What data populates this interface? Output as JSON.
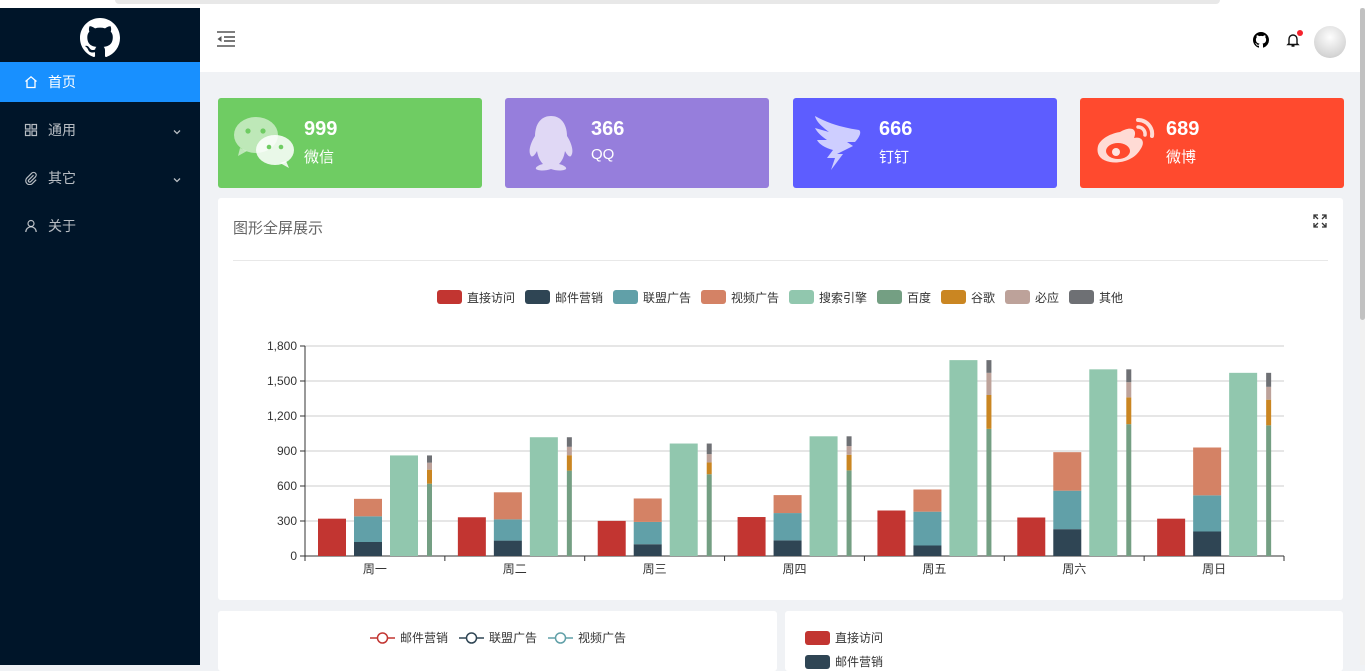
{
  "sidebar": {
    "items": [
      {
        "label": "首页",
        "icon": "home-icon",
        "active": true
      },
      {
        "label": "通用",
        "icon": "appstore-icon",
        "has_submenu": true
      },
      {
        "label": "其它",
        "icon": "paper-clip-icon",
        "has_submenu": true
      },
      {
        "label": "关于",
        "icon": "user-icon"
      }
    ]
  },
  "header": {
    "icons": [
      "menu-fold-icon",
      "github-icon",
      "bell-icon",
      "avatar"
    ]
  },
  "stats": [
    {
      "value": "999",
      "label": "微信",
      "color": "#6fcc63",
      "icon": "wechat-icon"
    },
    {
      "value": "366",
      "label": "QQ",
      "color": "#967edc",
      "icon": "qq-icon"
    },
    {
      "value": "666",
      "label": "钉钉",
      "color": "#5d5dff",
      "icon": "dingtalk-icon"
    },
    {
      "value": "689",
      "label": "微博",
      "color": "#ff4a2e",
      "icon": "weibo-icon"
    }
  ],
  "panel": {
    "title": "图形全屏展示"
  },
  "chart_data": {
    "type": "bar",
    "categories": [
      "周一",
      "周二",
      "周三",
      "周四",
      "周五",
      "周六",
      "周日"
    ],
    "y_ticks": [
      "0",
      "300",
      "600",
      "900",
      "1,200",
      "1,500",
      "1,800"
    ],
    "ylim": [
      0,
      1800
    ],
    "legend_position": "top-center",
    "grid": true,
    "series": [
      {
        "name": "直接访问",
        "stack": "direct",
        "color": "#c23531",
        "values": [
          320,
          332,
          301,
          334,
          390,
          330,
          320
        ]
      },
      {
        "name": "邮件营销",
        "stack": "ad",
        "color": "#2f4554",
        "values": [
          120,
          132,
          101,
          134,
          90,
          230,
          210
        ]
      },
      {
        "name": "联盟广告",
        "stack": "ad",
        "color": "#61a0a8",
        "values": [
          220,
          182,
          191,
          234,
          290,
          330,
          310
        ]
      },
      {
        "name": "视频广告",
        "stack": "ad",
        "color": "#d48265",
        "values": [
          150,
          232,
          201,
          154,
          190,
          330,
          410
        ]
      },
      {
        "name": "搜索引擎",
        "stack": "search",
        "color": "#91c7ae",
        "values": [
          862,
          1018,
          964,
          1026,
          1679,
          1600,
          1570
        ]
      },
      {
        "name": "百度",
        "stack": "engine",
        "color": "#749f83",
        "values": [
          620,
          732,
          701,
          734,
          1090,
          1130,
          1120
        ]
      },
      {
        "name": "谷歌",
        "stack": "engine",
        "color": "#ca8622",
        "values": [
          120,
          132,
          101,
          134,
          290,
          230,
          220
        ]
      },
      {
        "name": "必应",
        "stack": "engine",
        "color": "#bda29a",
        "values": [
          60,
          72,
          71,
          74,
          190,
          130,
          110
        ]
      },
      {
        "name": "其他",
        "stack": "engine",
        "color": "#6e7074",
        "values": [
          62,
          82,
          91,
          84,
          109,
          110,
          120
        ]
      }
    ]
  },
  "bottom_left_legend": [
    {
      "name": "邮件营销",
      "color": "#c23531"
    },
    {
      "name": "联盟广告",
      "color": "#2f4554"
    },
    {
      "name": "视频广告",
      "color": "#61a0a8"
    }
  ],
  "bottom_right_legend": [
    {
      "name": "直接访问",
      "color": "#c23531"
    },
    {
      "name": "邮件营销",
      "color": "#2f4554"
    }
  ]
}
